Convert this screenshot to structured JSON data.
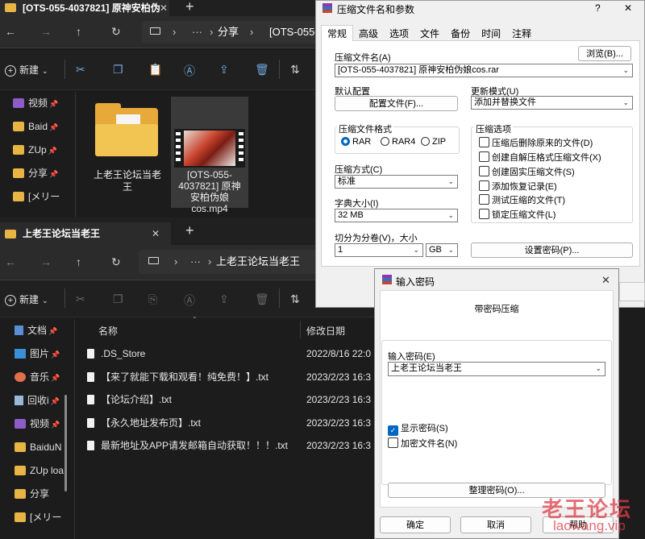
{
  "top_explorer": {
    "tab_title": "[OTS-055-4037821] 原神安柏伪",
    "new_tab": "+",
    "breadcrumb": [
      "分享",
      "[OTS-055-"
    ],
    "more": "···",
    "new_button": "新建",
    "sidebar": [
      "视频",
      "Baid",
      "ZUp",
      "分享",
      "[メリー"
    ],
    "files": [
      {
        "name": "上老王论坛当老王"
      },
      {
        "name": "[OTS-055-4037821] 原神安柏伪娘cos.mp4"
      }
    ]
  },
  "bottom_explorer": {
    "tab_title": "上老王论坛当老王",
    "new_tab": "+",
    "breadcrumb": [
      "上老王论坛当老王"
    ],
    "more": "···",
    "new_button": "新建",
    "sidebar": [
      "文档",
      "图片",
      "音乐",
      "回收i",
      "视频",
      "BaiduN",
      "ZUp loa",
      "分享",
      "[メリー"
    ],
    "columns": [
      "名称",
      "修改日期"
    ],
    "rows": [
      {
        "name": ".DS_Store",
        "date": "2022/8/16 22:0"
      },
      {
        "name": "【来了就能下载和观看！纯免费！】.txt",
        "date": "2023/2/23 16:3"
      },
      {
        "name": "【论坛介绍】.txt",
        "date": "2023/2/23 16:3"
      },
      {
        "name": "【永久地址发布页】.txt",
        "date": "2023/2/23 16:3"
      },
      {
        "name": "最新地址及APP请发邮箱自动获取！！！.txt",
        "date": "2023/2/23 16:3"
      }
    ]
  },
  "winrar": {
    "title": "压缩文件名和参数",
    "help": "?",
    "close": "✕",
    "tabs": [
      "常规",
      "高级",
      "选项",
      "文件",
      "备份",
      "时间",
      "注释"
    ],
    "archive_name_label": "压缩文件名(A)",
    "browse": "浏览(B)...",
    "archive_name": "[OTS-055-4037821] 原神安柏伪娘cos.rar",
    "default_profile_label": "默认配置",
    "profile_button": "配置文件(F)...",
    "update_mode_label": "更新模式(U)",
    "update_mode": "添加并替换文件",
    "format_label": "压缩文件格式",
    "formats": [
      "RAR",
      "RAR4",
      "ZIP"
    ],
    "selected_format": "RAR",
    "method_label": "压缩方式(C)",
    "method": "标准",
    "dict_label": "字典大小(I)",
    "dict": "32 MB",
    "split_label": "切分为分卷(V)，大小",
    "split_value": "1",
    "split_unit": "GB",
    "options_label": "压缩选项",
    "options": [
      {
        "label": "压缩后删除原来的文件(D)",
        "checked": false
      },
      {
        "label": "创建自解压格式压缩文件(X)",
        "checked": false
      },
      {
        "label": "创建固实压缩文件(S)",
        "checked": false
      },
      {
        "label": "添加恢复记录(E)",
        "checked": false
      },
      {
        "label": "测试压缩的文件(T)",
        "checked": false
      },
      {
        "label": "锁定压缩文件(L)",
        "checked": false
      }
    ],
    "set_password": "设置密码(P)..."
  },
  "password_dialog": {
    "title": "输入密码",
    "close": "✕",
    "heading": "带密码压缩",
    "input_label": "输入密码(E)",
    "password": "上老王论坛当老王",
    "show_password": "显示密码(S)",
    "show_password_checked": true,
    "encrypt_names": "加密文件名(N)",
    "encrypt_names_checked": false,
    "organize": "整理密码(O)...",
    "ok": "确定",
    "cancel": "取消",
    "help": "帮助"
  },
  "watermark": {
    "line1": "老王论坛",
    "line2": "laowang.vip"
  }
}
